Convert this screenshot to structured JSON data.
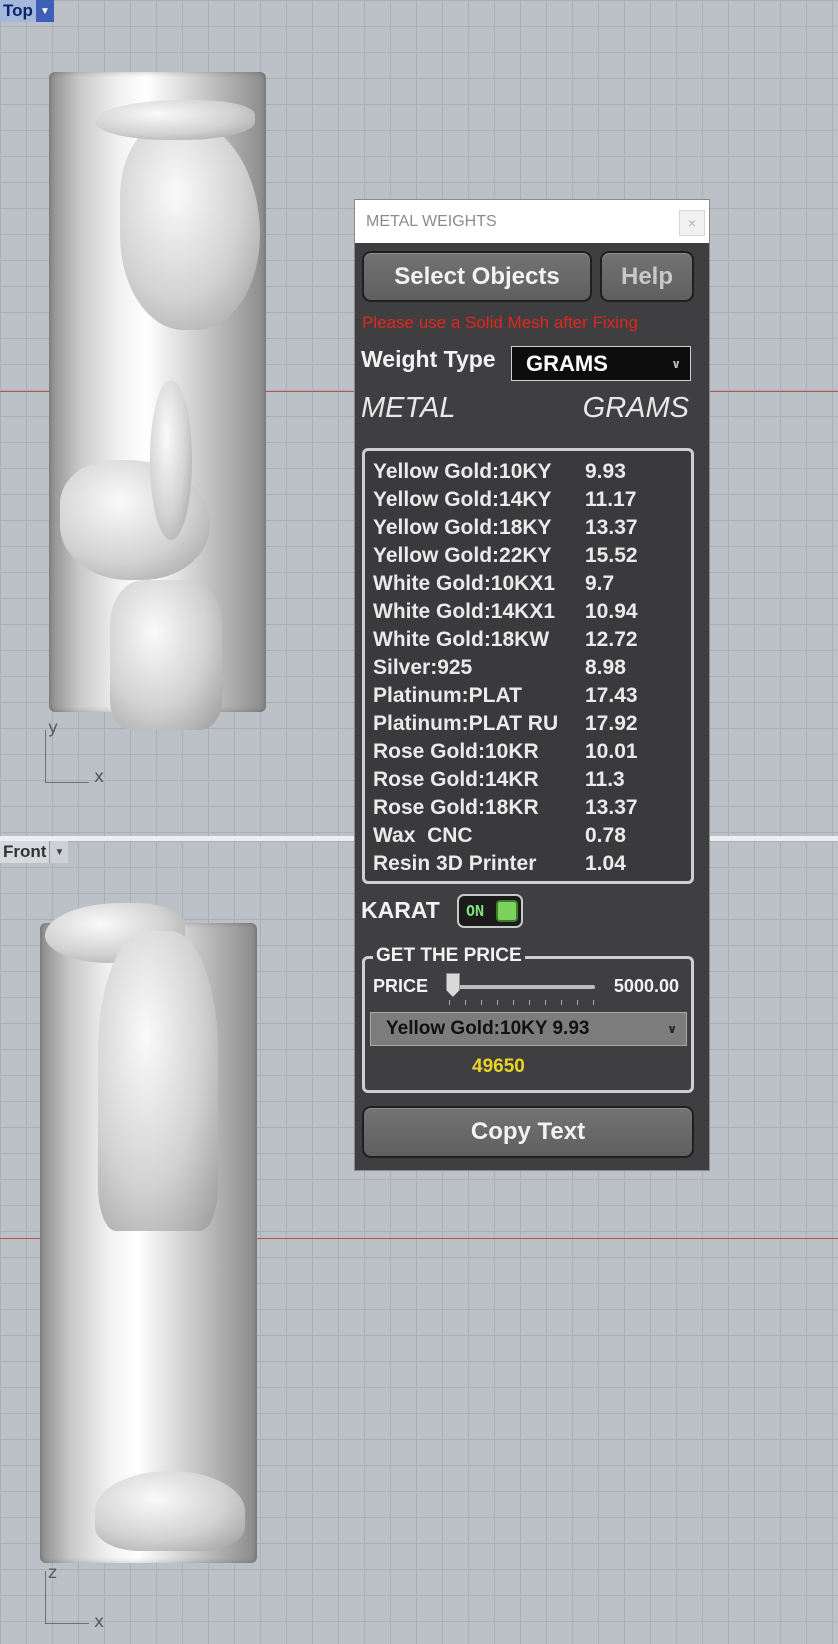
{
  "viewports": {
    "top": {
      "label": "Top",
      "axis_labels": [
        "y",
        "x"
      ]
    },
    "front": {
      "label": "Front",
      "axis_labels": [
        "z",
        "x"
      ]
    }
  },
  "panel": {
    "title": "METAL WEIGHTS",
    "close_icon": "×",
    "select_objects_label": "Select Objects",
    "help_label": "Help",
    "warning": "Please use a Solid Mesh after Fixing",
    "weight_type_label": "Weight Type",
    "weight_type_value": "GRAMS",
    "header_metal": "METAL",
    "header_grams": "GRAMS",
    "metals": [
      {
        "name": "Yellow Gold:10KY",
        "grams": "9.93"
      },
      {
        "name": "Yellow Gold:14KY",
        "grams": "11.17"
      },
      {
        "name": "Yellow Gold:18KY",
        "grams": "13.37"
      },
      {
        "name": "Yellow Gold:22KY",
        "grams": "15.52"
      },
      {
        "name": "White Gold:10KX1",
        "grams": "9.7"
      },
      {
        "name": "White Gold:14KX1",
        "grams": "10.94"
      },
      {
        "name": "White Gold:18KW",
        "grams": "12.72"
      },
      {
        "name": "Silver:925",
        "grams": "8.98"
      },
      {
        "name": "Platinum:PLAT",
        "grams": "17.43"
      },
      {
        "name": "Platinum:PLAT RU",
        "grams": "17.92"
      },
      {
        "name": "Rose Gold:10KR",
        "grams": "10.01"
      },
      {
        "name": "Rose Gold:14KR",
        "grams": "11.3"
      },
      {
        "name": "Rose Gold:18KR",
        "grams": "13.37"
      },
      {
        "name": "Wax  CNC",
        "grams": "0.78"
      },
      {
        "name": "Resin 3D Printer",
        "grams": "1.04"
      }
    ],
    "karat_label": "KARAT",
    "karat_toggle": {
      "text": "ON",
      "state": true
    },
    "price_group_title": "GET THE PRICE",
    "price_label": "PRICE",
    "price_slider_fraction": 0.02,
    "price_value": "5000.00",
    "metal_select_value": "Yellow Gold:10KY 9.93",
    "price_result": "49650",
    "copy_text_label": "Copy Text"
  },
  "colors": {
    "warning": "#e1261c",
    "result": "#e8d422",
    "toggle_on": "#7bd25d"
  },
  "icons": [
    "chevron-down-icon",
    "close-icon"
  ]
}
